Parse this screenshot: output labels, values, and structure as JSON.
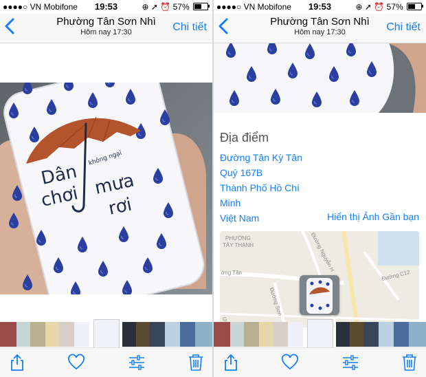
{
  "status": {
    "carrier": "●●●●○ VN Mobifone",
    "time": "19:53",
    "battery": "57%",
    "battery_level": 0.57
  },
  "nav": {
    "title": "Phường Tân Sơn Nhì",
    "subtitle": "Hôm nay 17:30",
    "detail_label": "Chi tiết"
  },
  "photo_text": {
    "line1": "Dân",
    "line2": "chơi",
    "line3": "mưa",
    "line4": "rơi",
    "small": "không ngại"
  },
  "location": {
    "heading": "Địa điểm",
    "address_lines": [
      "Đường Tân Kỳ Tân",
      "Quý 167B",
      "Thành Phố Hồ Chí",
      "Minh",
      "Việt Nam"
    ],
    "nearby_label": "Hiển thị Ảnh Gần bạn"
  },
  "map": {
    "labels": [
      "PHƯỜNG",
      "TÂY THẠNH",
      "Đường Nguyễn H",
      "ờng Tân",
      "Đường C12",
      "Đường Sơn",
      "G"
    ]
  },
  "toolbar": {
    "icons": [
      "share-icon",
      "heart-icon",
      "adjust-icon",
      "trash-icon"
    ]
  },
  "colors": {
    "accent": "#147efb",
    "drop": "#2b3fa0",
    "umbrella": "#b3542d"
  }
}
